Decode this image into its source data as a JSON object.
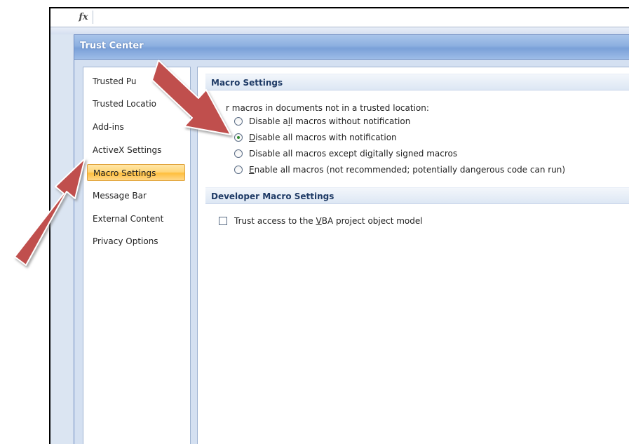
{
  "formula_bar": {
    "fx_label": "fx"
  },
  "dialog": {
    "title": "Trust Center"
  },
  "sidebar": {
    "items": [
      {
        "label": "Trusted Pu",
        "selected": false
      },
      {
        "label": "Trusted Locatio",
        "selected": false
      },
      {
        "label": "Add-ins",
        "selected": false
      },
      {
        "label": "ActiveX Settings",
        "selected": false
      },
      {
        "label": "Macro Settings",
        "selected": true
      },
      {
        "label": "Message Bar",
        "selected": false
      },
      {
        "label": "External Content",
        "selected": false
      },
      {
        "label": "Privacy Options",
        "selected": false
      }
    ]
  },
  "macro_settings": {
    "header": "Macro Settings",
    "description": "r macros in documents not in a trusted location:",
    "options": [
      {
        "pre": "Disable a",
        "key": "l",
        "post": "l macros without notification",
        "checked": false
      },
      {
        "pre": "",
        "key": "D",
        "post": "isable all macros with notification",
        "checked": true
      },
      {
        "pre": "Disable all macros except di",
        "key": "g",
        "post": "itally signed macros",
        "checked": false
      },
      {
        "pre": "",
        "key": "E",
        "post": "nable all macros (not recommended; potentially dangerous code can run)",
        "checked": false
      }
    ]
  },
  "developer_settings": {
    "header": "Developer Macro Settings",
    "checkbox": {
      "pre": "Trust access to the ",
      "key": "V",
      "post": "BA project object model",
      "checked": false
    }
  },
  "colors": {
    "selected_item": "#ffc85a",
    "title_bar": "#8db0e0",
    "annotation_arrow": "#c0504d"
  }
}
